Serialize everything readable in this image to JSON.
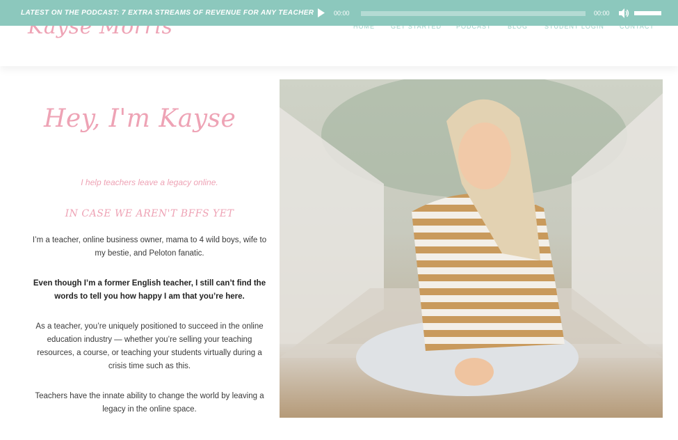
{
  "podcast_bar": {
    "label": "LATEST ON THE PODCAST: 7 EXTRA STREAMS OF REVENUE FOR ANY TEACHER",
    "current_time": "00:00",
    "total_time": "00:00",
    "play_icon": "play-icon",
    "volume_icon": "speaker-icon"
  },
  "header": {
    "logo": "Kayse Morris",
    "nav": [
      "HOME",
      "GET STARTED",
      "PODCAST",
      "BLOG",
      "STUDENT LOGIN",
      "CONTACT"
    ]
  },
  "intro": {
    "title": "Hey, I'm Kayse",
    "tagline": "I help teachers leave a legacy online.",
    "subheading": "In case we aren't BFFs yet",
    "paragraphs": [
      "I’m a teacher, online business owner, mama to 4 wild boys, wife to my bestie, and Peloton fanatic.",
      "Even though I’m a former English teacher, I still can’t find the words to tell you how happy I am that you’re here.",
      "As a teacher, you’re uniquely positioned to succeed in the online education industry — whether you’re selling your teaching resources, a course, or teaching your students virtually during a crisis time such as this.",
      "Teachers have the innate ability to change the world by leaving a legacy in the online space."
    ]
  },
  "colors": {
    "podcast_bar": "#8cc8bd",
    "brand_pink": "#eea3b5",
    "nav_teal": "#9cd0c7",
    "body_text": "#3a3a3a"
  }
}
